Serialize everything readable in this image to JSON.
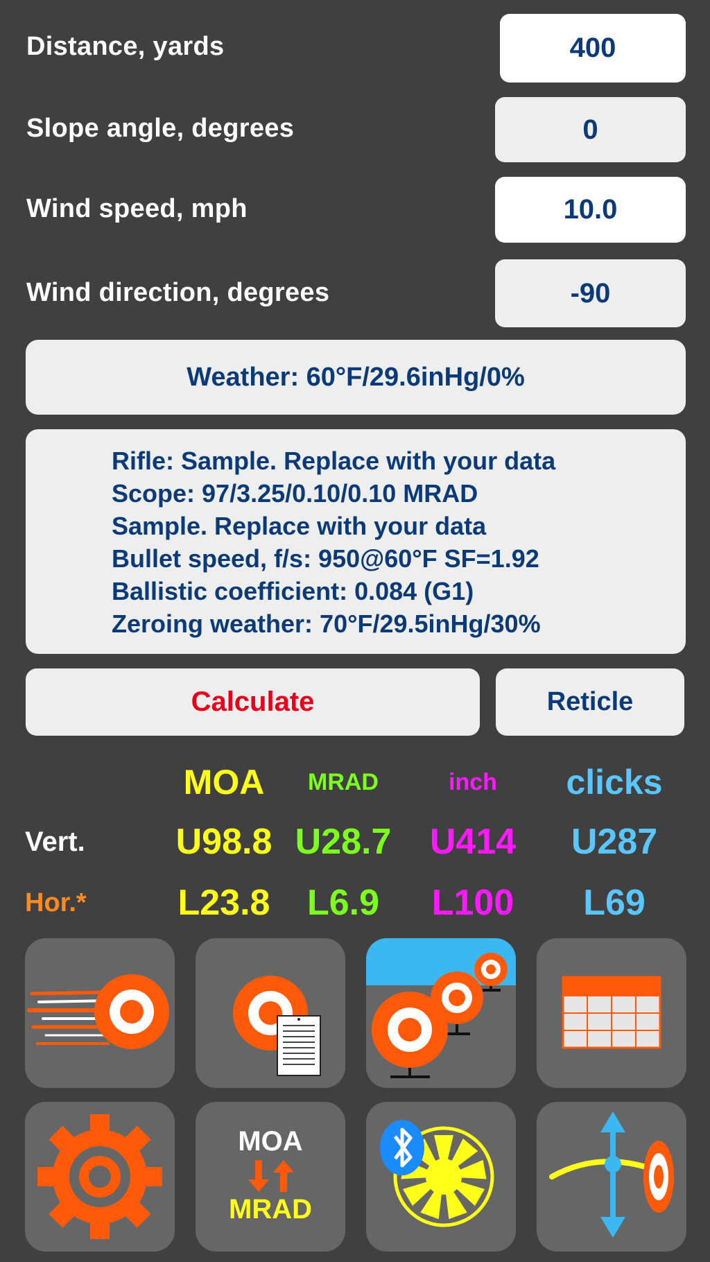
{
  "inputs": {
    "distance": {
      "label": "Distance, yards",
      "value": "400"
    },
    "slope": {
      "label": "Slope angle, degrees",
      "value": "0"
    },
    "wind_speed": {
      "label": "Wind speed, mph",
      "value": "10.0"
    },
    "wind_direction": {
      "label": "Wind direction, degrees",
      "value": "-90"
    }
  },
  "weather": "Weather: 60°F/29.6inHg/0%",
  "profile_lines": [
    "Rifle: Sample. Replace with your data",
    "Scope: 97/3.25/0.10/0.10 MRAD",
    "Sample. Replace with your data",
    "Bullet speed, f/s: 950@60°F SF=1.92",
    "Ballistic coefficient: 0.084 (G1)",
    "Zeroing weather: 70°F/29.5inHg/30%"
  ],
  "buttons": {
    "calculate": "Calculate",
    "reticle": "Reticle"
  },
  "results": {
    "units": [
      "MOA",
      "MRAD",
      "inch",
      "clicks"
    ],
    "vert_label": "Vert.",
    "hor_label": "Hor.*",
    "vert": [
      "U98.8",
      "U28.7",
      "U414",
      "U287"
    ],
    "hor": [
      "L23.8",
      "L6.9",
      "L100",
      "L69"
    ]
  },
  "tiles": {
    "convert_top": "MOA",
    "convert_bottom": "MRAD"
  },
  "icons": [
    "fast-target-icon",
    "target-notes-icon",
    "multiple-targets-icon",
    "range-table-icon",
    "settings-gear-icon",
    "moa-mrad-convert-icon",
    "bluetooth-wind-meter-icon",
    "trajectory-target-icon"
  ],
  "colors": {
    "background": "#404040",
    "field_text": "#0b3a78",
    "calculate": "#e8001a",
    "moa": "#ffff19",
    "mrad": "#7dff1e",
    "inch": "#ff19ff",
    "clicks": "#5ac6ff",
    "hor_label": "#ff8a1e",
    "icon_orange": "#ff5a0a",
    "tile": "#666666"
  }
}
